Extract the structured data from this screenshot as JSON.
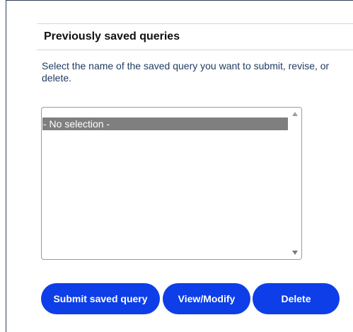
{
  "section": {
    "title": "Previously saved queries",
    "instructions": "Select the name of the saved query you want to submit, revise, or delete."
  },
  "saved_queries_list": {
    "options": [
      "- No selection -"
    ],
    "selected_option": "- No selection -"
  },
  "buttons": {
    "submit_label": "Submit saved query",
    "view_modify_label": "View/Modify",
    "delete_label": "Delete"
  },
  "colors": {
    "button_background": "#0d3ee8",
    "selected_option_background": "#7f7f7f",
    "instruction_text": "#1f3a5f"
  }
}
